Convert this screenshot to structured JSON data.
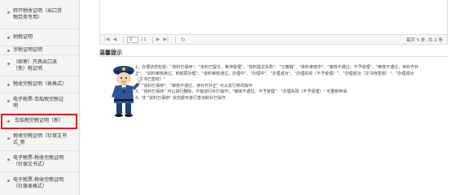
{
  "sidebar": {
    "items": [
      {
        "lines": [
          "转开税收证明（出口货",
          "物劳务专用）"
        ]
      },
      {
        "lines": [
          "纳税证明"
        ]
      },
      {
        "lines": [
          "涉税证明证明"
        ]
      },
      {
        "lines": [
          "（邮寄）开具出口退",
          "（免）税证明"
        ]
      },
      {
        "lines": [
          "税收完税证明（表格式）"
        ]
      },
      {
        "lines": [
          "电子税票-车船税完税证",
          "明"
        ]
      },
      {
        "lines": [
          "车船税完税证明（新）"
        ]
      },
      {
        "lines": [
          "税收完税证明（社保文书",
          "式_新"
        ]
      },
      {
        "lines": [
          "电子税票-税收完税证明",
          "（社保文书式）"
        ]
      },
      {
        "lines": [
          "电子税票-税收完税证明",
          "（社保表格式）"
        ]
      }
    ]
  },
  "pager": {
    "first": "|◀",
    "prev": "◀",
    "page_value": "1",
    "page_total": "/ 1",
    "next": "▶",
    "last": "▶|",
    "refresh": "↻",
    "info": "每页 5 条, 共 2 条"
  },
  "tips": {
    "title": "温馨提示",
    "lines": [
      "1、办理状态包括：\"资料已保存\"、\"资料已提交，等待受理\"、\"资料提交失败\"、\"已撤销\"、\"资料审核中\"、\"审核不通过，不予受理\"、\"审核不通过，待补齐补",
      "正\"、\"资料审核通过，到税局办理\"、\"资料审核通过，办理中\"、\"办理中\"、\"办理成功\"、\"办理失败（不予受理）\"、\"办理成功（文书待签收）\"、\"办理成功",
      "（文书已签收）\"",
      "2、\"资料已保存\"、\"审核不通过，待补齐补正\" 可以进行修改操作",
      "3、\"资料已保存\" 可以进行删除，不能进行补打操作；\"审核不通过，不予受理\"、\"办理失败（不予受理）\" 可重新申请",
      "4、非 \"资料已保存\" 状态都可进行查询和补打操作"
    ]
  },
  "colors": {
    "highlight_border": "#e02020",
    "sidebar_bg": "#f4f4f4",
    "pager_icon": "#7a9bbf",
    "refresh_icon": "#3b9c3b"
  }
}
